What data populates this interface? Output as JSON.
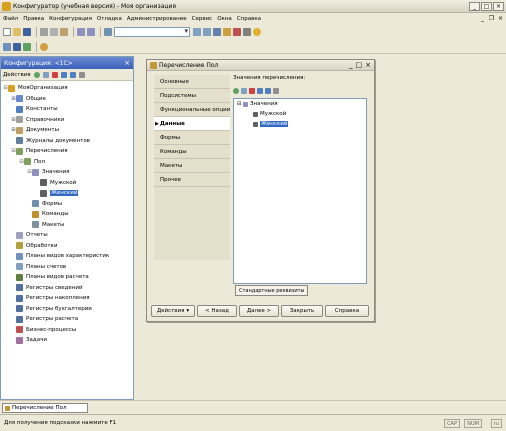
{
  "window": {
    "title": "Конфигуратор (учебная версия) - Моя организация"
  },
  "menubar": {
    "items": [
      "Файл",
      "Правка",
      "Конфигурация",
      "Отладка",
      "Администрирование",
      "Сервис",
      "Окна",
      "Справка"
    ]
  },
  "config_panel": {
    "title": "Конфигурация: <1С>",
    "tools_label": "Действия",
    "tree": [
      {
        "label": "МояОрганизация",
        "level": 0,
        "expander": "-",
        "color": "#d8a020"
      },
      {
        "label": "Общие",
        "level": 1,
        "expander": "+",
        "color": "#6a8ad0"
      },
      {
        "label": "Константы",
        "level": 1,
        "expander": "",
        "color": "#5080c0"
      },
      {
        "label": "Справочники",
        "level": 1,
        "expander": "+",
        "color": "#a0a0a0"
      },
      {
        "label": "Документы",
        "level": 1,
        "expander": "+",
        "color": "#c0a060"
      },
      {
        "label": "Журналы документов",
        "level": 1,
        "expander": "",
        "color": "#6080a0"
      },
      {
        "label": "Перечисления",
        "level": 1,
        "expander": "-",
        "color": "#80a060"
      },
      {
        "label": "Пол",
        "level": 2,
        "expander": "-",
        "color": "#80a060"
      },
      {
        "label": "Значения",
        "level": 3,
        "expander": "-",
        "color": "#9090c0"
      },
      {
        "label": "Мужской",
        "level": 4,
        "expander": "",
        "color": "#606060"
      },
      {
        "label": "Женский",
        "level": 4,
        "expander": "",
        "color": "#606060",
        "selected": true
      },
      {
        "label": "Формы",
        "level": 3,
        "expander": "",
        "color": "#7090b0"
      },
      {
        "label": "Команды",
        "level": 3,
        "expander": "",
        "color": "#c09030"
      },
      {
        "label": "Макеты",
        "level": 3,
        "expander": "",
        "color": "#8090a0"
      },
      {
        "label": "Отчеты",
        "level": 1,
        "expander": "",
        "color": "#a0a0c0"
      },
      {
        "label": "Обработки",
        "level": 1,
        "expander": "",
        "color": "#b0a040"
      },
      {
        "label": "Планы видов характеристик",
        "level": 1,
        "expander": "",
        "color": "#7090c0"
      },
      {
        "label": "Планы счетов",
        "level": 1,
        "expander": "",
        "color": "#80a0c0"
      },
      {
        "label": "Планы видов расчета",
        "level": 1,
        "expander": "",
        "color": "#608040"
      },
      {
        "label": "Регистры сведений",
        "level": 1,
        "expander": "",
        "color": "#5070a0"
      },
      {
        "label": "Регистры накопления",
        "level": 1,
        "expander": "",
        "color": "#5070a0"
      },
      {
        "label": "Регистры бухгалтерии",
        "level": 1,
        "expander": "",
        "color": "#5070a0"
      },
      {
        "label": "Регистры расчета",
        "level": 1,
        "expander": "",
        "color": "#5070a0"
      },
      {
        "label": "Бизнес-процессы",
        "level": 1,
        "expander": "",
        "color": "#c05050"
      },
      {
        "label": "Задачи",
        "level": 1,
        "expander": "",
        "color": "#a070a0"
      }
    ]
  },
  "child_window": {
    "title": "Перечисление Пол",
    "tabs": [
      "Основные",
      "Подсистемы",
      "Функциональные опции",
      "Данные",
      "Формы",
      "Команды",
      "Макеты",
      "Прочее"
    ],
    "active_tab": "Данные",
    "content_header": "Значения перечисления:",
    "values_tree": [
      {
        "label": "Значения",
        "level": 0,
        "expander": "-"
      },
      {
        "label": "Мужской",
        "level": 1,
        "expander": ""
      },
      {
        "label": "Женский",
        "level": 1,
        "expander": "",
        "selected": true
      }
    ],
    "predefined_btn": "Стандартные реквизиты",
    "buttons": {
      "actions": "Действия",
      "back": "< Назад",
      "next": "Далее >",
      "close": "Закрыть",
      "help": "Справка"
    }
  },
  "window_bar": {
    "tab": "Перечисление Пол"
  },
  "status": {
    "text": "Для получения подсказки нажмите F1",
    "cap": "CAP",
    "num": "NUM",
    "lang": "ru"
  }
}
